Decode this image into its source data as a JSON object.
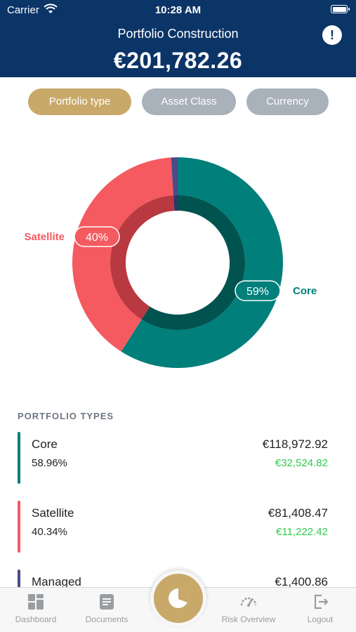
{
  "status": {
    "carrier": "Carrier",
    "time": "10:28 AM"
  },
  "header": {
    "title": "Portfolio Construction",
    "total": "€201,782.26",
    "alert_symbol": "!"
  },
  "segments": [
    {
      "label": "Portfolio type",
      "active": true
    },
    {
      "label": "Asset Class",
      "active": false
    },
    {
      "label": "Currency",
      "active": false
    }
  ],
  "chart_data": {
    "type": "pie",
    "series": [
      {
        "name": "Core",
        "value": 59,
        "label": "59%",
        "color": "#007f7b",
        "inner_color": "#00534f"
      },
      {
        "name": "Satellite",
        "value": 40,
        "label": "40%",
        "color": "#f45a5f",
        "inner_color": "#b8393f"
      },
      {
        "name": "Managed",
        "value": 1,
        "label": "",
        "color": "#4b4a8a",
        "inner_color": "#33326a"
      }
    ]
  },
  "list": {
    "header": "PORTFOLIO TYPES",
    "items": [
      {
        "name": "Core",
        "percent": "58.96%",
        "amount": "€118,972.92",
        "gain": "€32,524.82",
        "color": "#007f7b"
      },
      {
        "name": "Satellite",
        "percent": "40.34%",
        "amount": "€81,408.47",
        "gain": "€11,222.42",
        "color": "#f45a5f"
      },
      {
        "name": "Managed",
        "percent": "",
        "amount": "€1,400.86",
        "gain": "",
        "color": "#4b4a8a"
      }
    ]
  },
  "tabs": {
    "dashboard": "Dashboard",
    "documents": "Documents",
    "risk": "Risk Overview",
    "logout": "Logout"
  }
}
